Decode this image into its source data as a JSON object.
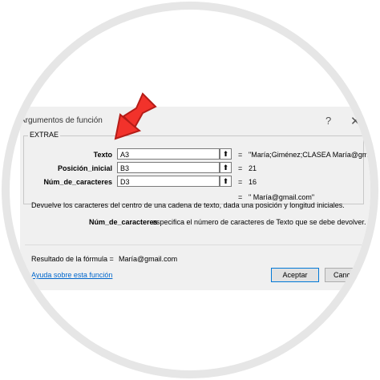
{
  "dialog": {
    "title": "Argumentos de función",
    "help_glyph": "?",
    "close_glyph": "✕",
    "function_name": "EXTRAE",
    "args": [
      {
        "label": "Texto",
        "value": "A3",
        "eq": "=",
        "result": "\"María;Giménez;CLASEA María@gmail"
      },
      {
        "label": "Posición_inicial",
        "value": "B3",
        "eq": "=",
        "result": "21"
      },
      {
        "label": "Núm_de_caracteres",
        "value": "D3",
        "eq": "=",
        "result": "16"
      }
    ],
    "total_eq": "=",
    "total_result": "\" María@gmail.com\"",
    "description": "Devuelve los caracteres del centro de una cadena de texto, dada una posición y longitud iniciales.",
    "arg_desc_name": "Núm_de_caracteres",
    "arg_desc_text": "especifica el número de caracteres de Texto que se debe devolver.",
    "formula_label": "Resultado de la fórmula =",
    "formula_value": "María@gmail.com",
    "help_link": "Ayuda sobre esta función",
    "ok_label": "Aceptar",
    "cancel_label": "Cancelar"
  },
  "icons": {
    "collapse_button": "collapse-dialog-icon",
    "arrow": "red-arrow-icon"
  },
  "colors": {
    "arrow_fill": "#f2322b",
    "link": "#0066cc",
    "dialog_bg": "#f0f0f0"
  }
}
